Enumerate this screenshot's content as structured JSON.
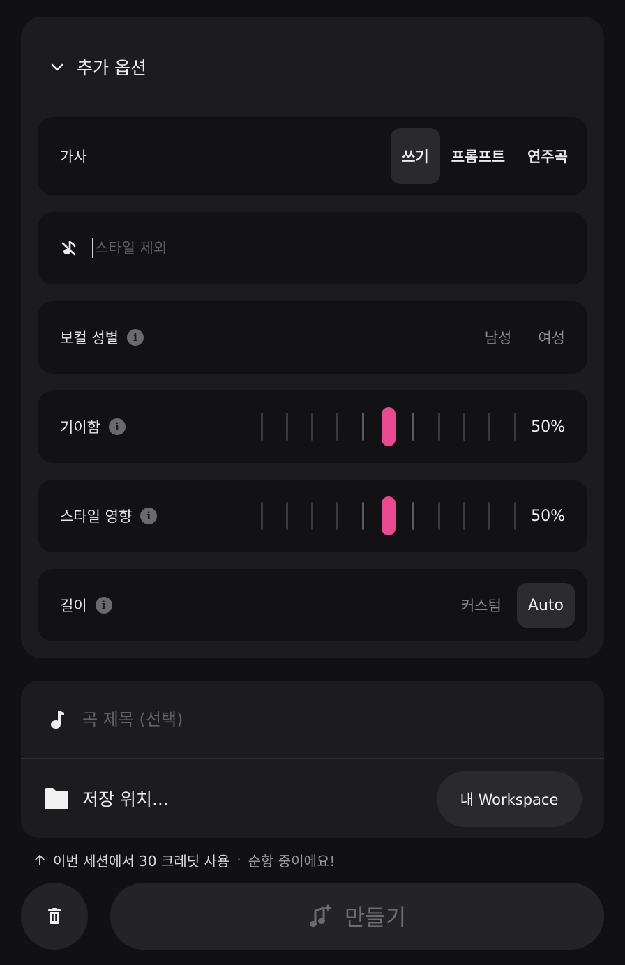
{
  "options": {
    "header": "추가 옵션",
    "lyrics": {
      "label": "가사",
      "modes": [
        "쓰기",
        "프롬프트",
        "연주곡"
      ],
      "active_mode": "쓰기"
    },
    "exclude_styles": {
      "placeholder": "스타일 제외",
      "value": ""
    },
    "vocal_gender": {
      "label": "보컬 성별",
      "options": [
        "남성",
        "여성"
      ]
    },
    "weirdness": {
      "label": "기이함",
      "value_text": "50%",
      "value": 0.5
    },
    "style_influence": {
      "label": "스타일 영향",
      "value_text": "50%",
      "value": 0.5
    },
    "length": {
      "label": "길이",
      "custom_label": "커스텀",
      "auto_label": "Auto",
      "selected": "Auto"
    }
  },
  "song": {
    "title_placeholder": "곡 제목 (선택)",
    "save_label": "저장 위치...",
    "workspace_label": "내 Workspace"
  },
  "credits": {
    "used_text": "이번 세션에서 30 크레딧 사용",
    "separator": "·",
    "status_text": "순항 중이에요!"
  },
  "actions": {
    "create_label": "만들기"
  },
  "colors": {
    "accent": "#e9498f",
    "background": "#111113",
    "panel": "#1c1c1f",
    "row": "#121214"
  }
}
